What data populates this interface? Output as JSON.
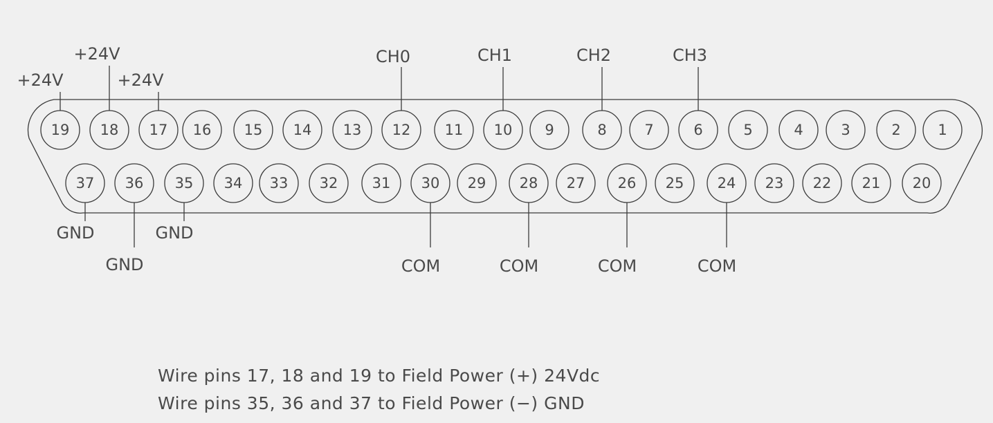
{
  "connector": {
    "top_row": [
      "19",
      "18",
      "17",
      "16",
      "15",
      "14",
      "13",
      "12",
      "11",
      "10",
      "9",
      "8",
      "7",
      "6",
      "5",
      "4",
      "3",
      "2",
      "1"
    ],
    "bottom_row": [
      "37",
      "36",
      "35",
      "34",
      "33",
      "32",
      "31",
      "30",
      "29",
      "28",
      "27",
      "26",
      "25",
      "24",
      "23",
      "22",
      "21",
      "20"
    ]
  },
  "labels": {
    "top": [
      {
        "pin": "19",
        "text": "+24V"
      },
      {
        "pin": "18",
        "text": "+24V"
      },
      {
        "pin": "17",
        "text": "+24V"
      },
      {
        "pin": "12",
        "text": "CH0"
      },
      {
        "pin": "10",
        "text": "CH1"
      },
      {
        "pin": "8",
        "text": "CH2"
      },
      {
        "pin": "6",
        "text": "CH3"
      }
    ],
    "bottom": [
      {
        "pin": "37",
        "text": "GND"
      },
      {
        "pin": "36",
        "text": "GND"
      },
      {
        "pin": "35",
        "text": "GND"
      },
      {
        "pin": "30",
        "text": "COM"
      },
      {
        "pin": "28",
        "text": "COM"
      },
      {
        "pin": "26",
        "text": "COM"
      },
      {
        "pin": "24",
        "text": "COM"
      }
    ]
  },
  "notes": {
    "line1": "Wire pins 17, 18 and 19 to Field Power (+) 24Vdc",
    "line2": "Wire pins 35, 36 and 37 to Field Power (−) GND"
  }
}
